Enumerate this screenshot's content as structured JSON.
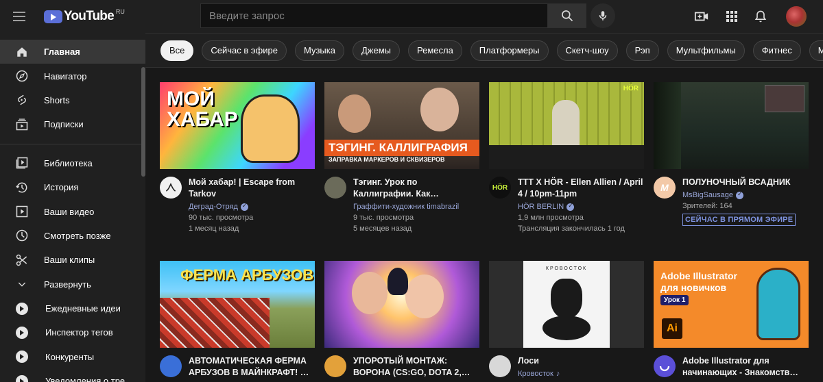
{
  "header": {
    "logo_text": "YouTube",
    "region": "RU",
    "search_placeholder": "Введите запрос",
    "icons": [
      "menu-icon",
      "search-icon",
      "microphone-icon",
      "create-video-icon",
      "apps-icon",
      "notifications-icon"
    ]
  },
  "sidebar": {
    "main": [
      {
        "label": "Главная",
        "icon": "home-icon",
        "active": true
      },
      {
        "label": "Навигатор",
        "icon": "compass-icon"
      },
      {
        "label": "Shorts",
        "icon": "shorts-icon"
      },
      {
        "label": "Подписки",
        "icon": "subscriptions-icon"
      }
    ],
    "library": [
      {
        "label": "Библиотека",
        "icon": "library-icon"
      },
      {
        "label": "История",
        "icon": "history-icon"
      },
      {
        "label": "Ваши видео",
        "icon": "your-videos-icon"
      },
      {
        "label": "Смотреть позже",
        "icon": "watch-later-icon"
      },
      {
        "label": "Ваши клипы",
        "icon": "clips-icon"
      },
      {
        "label": "Развернуть",
        "icon": "chevron-down-icon"
      }
    ],
    "playlists": [
      {
        "label": "Ежедневные идеи"
      },
      {
        "label": "Инспектор тегов"
      },
      {
        "label": "Конкуренты"
      },
      {
        "label": "Уведомления о тре"
      }
    ]
  },
  "chips": [
    "Все",
    "Сейчас в эфире",
    "Музыка",
    "Джемы",
    "Ремесла",
    "Платформеры",
    "Скетч-шоу",
    "Рэп",
    "Мультфильмы",
    "Фитнес",
    "Minecraft Bed"
  ],
  "videos": [
    {
      "title": "Мой хабар! | Escape from Tarkov",
      "channel": "Деград-Отряд",
      "verified": true,
      "views": "90 тыс. просмотра",
      "age": "1 месяц назад",
      "thumb_text": "МОЙ ХАБАР",
      "avatar_bg": "#f1f1f1",
      "avatar_text": "Д"
    },
    {
      "title": "Тэгинг. Урок по Каллиграфии. Как…",
      "channel": "Граффити-художник timabrazil",
      "verified": false,
      "views": "9 тыс. просмотра",
      "age": "5 месяцев назад",
      "thumb_text": "ТЭГИНГ. КАЛЛИГРАФИЯ",
      "thumb_sub": "ЗАПРАВКА МАРКЕРОВ И СКВИЗЕРОВ",
      "avatar_bg": "#6b6b5a",
      "avatar_text": ""
    },
    {
      "title": "TTT X HÖR - Ellen Allien / April 4 / 10pm-11pm",
      "channel": "HÖR BERLIN",
      "verified": true,
      "views": "1,9 млн просмотра",
      "age": "Трансляция закончилась 1 год",
      "thumb_text": "HÖR",
      "avatar_bg": "#0f0f0f",
      "avatar_text": "HÖR"
    },
    {
      "title": "ПОЛУНОЧНЫЙ ВСАДНИК",
      "channel": "MsBigSausage",
      "verified": true,
      "views": "Зрителей: 164",
      "live_label": "СЕЙЧАС В ПРЯМОМ ЭФИРЕ",
      "avatar_bg": "#f3c9a8",
      "avatar_text": "M"
    },
    {
      "title": "АВТОМАТИЧЕСКАЯ ФЕРМА АРБУЗОВ В МАЙНКРАФТ! …",
      "channel": "",
      "thumb_text": "ФЕРМА АРБУЗОВ",
      "avatar_bg": "#3a6fd8",
      "avatar_text": ""
    },
    {
      "title": "УПОРОТЫЙ МОНТАЖ: ВОРОНА (CS:GO, DOTA 2,…",
      "channel": "",
      "avatar_bg": "#e3a13a",
      "avatar_text": ""
    },
    {
      "title": "Лоси",
      "channel": "Кровосток",
      "music": true,
      "thumb_text": "КРОВОСТОК",
      "avatar_bg": "#d8d8d8",
      "avatar_text": ""
    },
    {
      "title": "Adobe Illustrator для начинающих - Знакомств…",
      "channel": "",
      "thumb_text": "Adobe Illustrator для новичков",
      "thumb_badge": "Урок 1",
      "thumb_logo": "Ai",
      "avatar_bg": "#5b4fd8",
      "avatar_text": ""
    }
  ],
  "colors": {
    "accent": "#3ea6ff",
    "link": "#9aa7d9",
    "chip_active": "#f1f1f1"
  }
}
